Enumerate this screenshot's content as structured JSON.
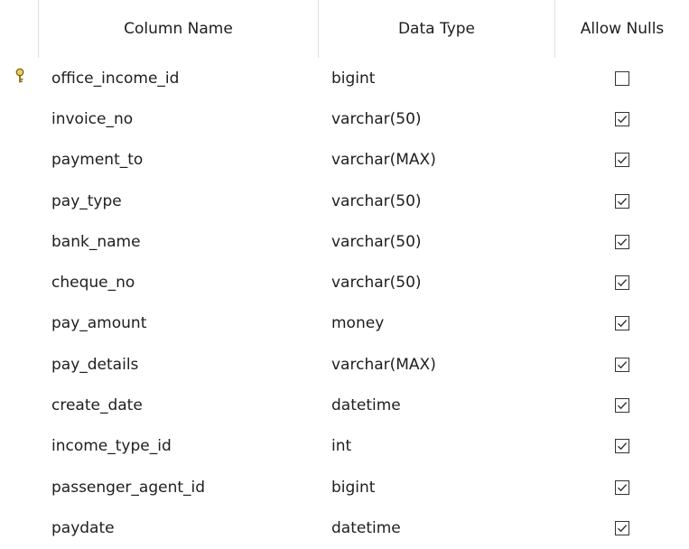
{
  "header": {
    "column_name": "Column Name",
    "data_type": "Data Type",
    "allow_nulls": "Allow Nulls"
  },
  "rows": [
    {
      "name": "office_income_id",
      "type": "bigint",
      "allow_nulls": false,
      "primary_key": true
    },
    {
      "name": "invoice_no",
      "type": "varchar(50)",
      "allow_nulls": true,
      "primary_key": false
    },
    {
      "name": "payment_to",
      "type": "varchar(MAX)",
      "allow_nulls": true,
      "primary_key": false
    },
    {
      "name": "pay_type",
      "type": "varchar(50)",
      "allow_nulls": true,
      "primary_key": false
    },
    {
      "name": "bank_name",
      "type": "varchar(50)",
      "allow_nulls": true,
      "primary_key": false
    },
    {
      "name": "cheque_no",
      "type": "varchar(50)",
      "allow_nulls": true,
      "primary_key": false
    },
    {
      "name": "pay_amount",
      "type": "money",
      "allow_nulls": true,
      "primary_key": false
    },
    {
      "name": "pay_details",
      "type": "varchar(MAX)",
      "allow_nulls": true,
      "primary_key": false
    },
    {
      "name": "create_date",
      "type": "datetime",
      "allow_nulls": true,
      "primary_key": false
    },
    {
      "name": "income_type_id",
      "type": "int",
      "allow_nulls": true,
      "primary_key": false
    },
    {
      "name": "passenger_agent_id",
      "type": "bigint",
      "allow_nulls": true,
      "primary_key": false
    },
    {
      "name": "paydate",
      "type": "datetime",
      "allow_nulls": true,
      "primary_key": false
    }
  ],
  "icons": {
    "primary_key": "key-icon",
    "checked": "checkbox-checked-icon",
    "unchecked": "checkbox-unchecked-icon"
  },
  "colors": {
    "key_gold": "#d4a017",
    "checkbox_border": "#333333"
  }
}
